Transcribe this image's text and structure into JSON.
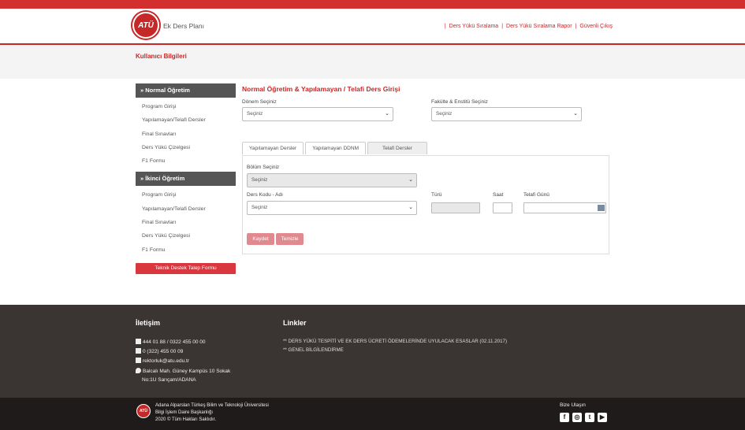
{
  "header": {
    "logo_text": "ATÜ",
    "app_title": "Ek Ders Planı",
    "nav": [
      "Ders Yükü Sıralama",
      "Ders Yükü Sıralama Rapor",
      "Güvenli Çıkış"
    ]
  },
  "subbar": {
    "title": "Kullanıcı Bilgileri"
  },
  "sidebar": {
    "section1": {
      "title": "» Normal Öğretim",
      "items": [
        "Program Girişi",
        "Yapılamayan/Telafi Dersler",
        "Final Sınavları",
        "Ders Yükü Çizelgesi",
        "F1 Formu"
      ]
    },
    "section2": {
      "title": "» İkinci Öğretim",
      "items": [
        "Program Girişi",
        "Yapılamayan/Telafi Dersler",
        "Final Sınavları",
        "Ders Yükü Çizelgesi",
        "F1 Formu"
      ]
    },
    "support_button": "Teknik Destek Talep Formu"
  },
  "content": {
    "title": "Normal Öğretim & Yapılamayan / Telafi Ders Girişi",
    "donem_label": "Dönem Seçiniz",
    "donem_value": "Seçiniz",
    "fakulte_label": "Fakülte & Enstitü Seçiniz",
    "fakulte_value": "Seçiniz",
    "tabs": [
      "Yapılamayan Dersler",
      "Yapılamayan DDNM",
      "Telafi Dersler"
    ],
    "bolum_label": "Bölüm Seçiniz",
    "bolum_value": "Seçiniz",
    "ders_label": "Ders Kodu - Adı",
    "ders_value": "Seçiniz",
    "turu_label": "Türü",
    "saat_label": "Saat",
    "telafi_label": "Telafi Günü",
    "save_button": "Kaydet",
    "clear_button": "Temizle"
  },
  "footer": {
    "contact_title": "İletişim",
    "phone": "444 01 88  / 0322 455 00 00",
    "fax": "0 (322) 455 00 09",
    "email": "rektorluk@atu.edu.tr",
    "address1": "Balcalı Mah. Güney Kampüs 10 Sokak",
    "address2": "No:1U Sarıçam/ADANA",
    "links_title": "Linkler",
    "link1": "** DERS YÜKÜ TESPİTİ VE EK DERS ÜCRETİ ÖDEMELERİNDE UYULACAK ESASLAR (02.11.2017)",
    "link2": "** GENEL BİLGİLENDİRME"
  },
  "bottom": {
    "logo_text": "ATÜ",
    "line1": "Adana Alparslan Türkeş Bilim ve Teknoloji Üniversitesi",
    "line2": "Bilgi İşlem Daire Başkanlığı",
    "line3": "2020 © Tüm Hakları Saklıdır.",
    "social_title": "Bize Ulaşın"
  }
}
